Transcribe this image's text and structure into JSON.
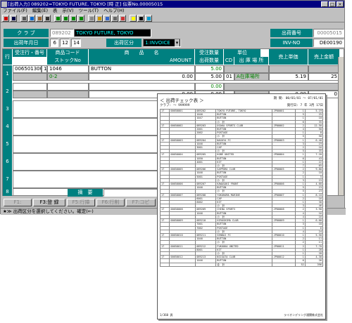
{
  "window": {
    "title": "[出荷入力] 089202=TOKYO FUTURE, TOKYO [時   正] 伝票No.00005015",
    "controls": [
      "_",
      "□",
      "×"
    ]
  },
  "menu": [
    "ファイル(F)",
    "編集(E)",
    "表",
    "示(V)",
    "ツール(T)",
    "ヘルプ(H)"
  ],
  "header": {
    "club_label": "ク ラ ブ",
    "club_code": "089202",
    "club_name": "TOKYO FUTURE, TOKYO",
    "shipment_no_label": "出荷番号",
    "shipment_no": "00005015",
    "ship_date_label": "出荷年月日",
    "ship_date_parts": [
      "6",
      "12",
      "14"
    ],
    "ship_div_label": "出荷区分",
    "ship_div_value": "1:INVOICE",
    "inv_no_label": "INV-NO",
    "inv_no": "DE00190"
  },
  "grid": {
    "columns": {
      "row": "行",
      "order_no": "受注行・番号",
      "product_code": "商品コード",
      "stock_no": "ストックNo",
      "product_name": "商　　品　　名",
      "amount": "AMOUNT",
      "order_qty": "受注数量",
      "ship_qty": "出荷数量",
      "cd": "CD",
      "unit": "単位",
      "location": "出 庫 場 所",
      "price": "売上単価",
      "sales_amount": "売上金額"
    },
    "rows": [
      {
        "num": "1",
        "order_no": "006501300",
        "order_line": "1",
        "product_code": "1046",
        "product_name": "BUTTON",
        "order_qty": "5.00",
        "ship_qty": "5.00",
        "unit": "01",
        "price": "5.19",
        "sales_amount": "25",
        "stock_no": "0-2",
        "amount": "0.00",
        "qty2": "0.00",
        "cd2": "01",
        "location": "A在庫場所"
      },
      {
        "num": "2",
        "amount": "0.00",
        "ship_qty": "0.00",
        "cd2": "",
        "price": "0.00",
        "sales_amount": "0",
        "order_qty": "0.00"
      },
      {
        "num": "3"
      },
      {
        "num": "4"
      },
      {
        "num": "5"
      },
      {
        "num": "6"
      },
      {
        "num": "7"
      },
      {
        "num": "8"
      }
    ],
    "summary_label": "摘　要"
  },
  "buttons": {
    "f1": "F1:",
    "f3": "F3:登 録",
    "f5": "F5:行挿",
    "f6": "F6:行削",
    "f7": "F7:コピ"
  },
  "status_message": "★≫ 出荷区分を選択してください。確定(←)",
  "report": {
    "title": "＜ 出荷チェック表 ＞",
    "club_label": "クラブ:",
    "club_range": "～ 999999",
    "period_label": "期 間: 00/01/01 ～ 07/01/01",
    "print_date": "発行日: 7 年 3月 17日",
    "page_label": "1",
    "rows": [
      [
        "17",
        "00650001",
        "089202",
        "TOKYO FUTURE, TOKYO",
        "JP00001",
        "1",
        "5.19"
      ],
      [
        "",
        "",
        "1046",
        "BUTTON",
        "",
        "5",
        "25"
      ],
      [
        "",
        "",
        "1047",
        "BUTTON",
        "",
        "1",
        "10"
      ],
      [
        "",
        "",
        "",
        "小　計",
        "",
        "6",
        "35"
      ],
      [
        "17",
        "00650002",
        "089203",
        "OSAKA SPORTS CLUB",
        "JP00002",
        "2",
        "12.50"
      ],
      [
        "",
        "",
        "2001",
        "BUTTON",
        "",
        "4",
        "50"
      ],
      [
        "",
        "",
        "2002",
        "POSTAGE",
        "",
        "1",
        "8"
      ],
      [
        "",
        "",
        "",
        "小　計",
        "",
        "5",
        "58"
      ],
      [
        "17",
        "00650003",
        "089204",
        "NAGOYA FC",
        "JP00003",
        "1",
        "6.40"
      ],
      [
        "",
        "",
        "1046",
        "BUTTON",
        "",
        "3",
        "19"
      ],
      [
        "",
        "",
        "3001",
        "CAP",
        "",
        "2",
        "16"
      ],
      [
        "",
        "",
        "",
        "小　計",
        "",
        "5",
        "35"
      ],
      [
        "17",
        "00650004",
        "089205",
        "KOBE UNITED",
        "JP00004",
        "1",
        "7.20"
      ],
      [
        "",
        "",
        "1050",
        "BUTTON",
        "",
        "6",
        "43"
      ],
      [
        "",
        "",
        "4001",
        "KIT",
        "",
        "1",
        "22"
      ],
      [
        "",
        "",
        "",
        "小　計",
        "",
        "7",
        "65"
      ],
      [
        "17",
        "00650005",
        "089206",
        "SAPPORO CLUB",
        "JP00005",
        "2",
        "9.80"
      ],
      [
        "",
        "",
        "1046",
        "BUTTON",
        "",
        "2",
        "10"
      ],
      [
        "",
        "",
        "5001",
        "POSTAGE",
        "",
        "1",
        "5"
      ],
      [
        "",
        "",
        "",
        "小　計",
        "",
        "3",
        "15"
      ],
      [
        "17",
        "00650006",
        "089207",
        "KAWASAKI FRONT",
        "JP00006",
        "1",
        "4.60"
      ],
      [
        "",
        "",
        "1046",
        "BUTTON",
        "",
        "5",
        "23"
      ],
      [
        "",
        "",
        "",
        "小　計",
        "",
        "5",
        "23"
      ],
      [
        "17",
        "00650007",
        "089208",
        "YOKOHAMA MARINE",
        "JP00007",
        "1",
        "8.10"
      ],
      [
        "",
        "",
        "6001",
        "CAP",
        "",
        "2",
        "16"
      ],
      [
        "",
        "",
        "6002",
        "KIT",
        "",
        "1",
        "30"
      ],
      [
        "",
        "",
        "",
        "小　計",
        "",
        "3",
        "46"
      ],
      [
        "17",
        "00650008",
        "089209",
        "CHIBA SPORTS",
        "JP00008",
        "2",
        "3.90"
      ],
      [
        "",
        "",
        "1046",
        "BUTTON",
        "",
        "4",
        "16"
      ],
      [
        "",
        "",
        "",
        "小　計",
        "",
        "4",
        "16"
      ],
      [
        "17",
        "00650009",
        "089210",
        "HIROSHIMA CLUB",
        "JP00009",
        "1",
        "6.00"
      ],
      [
        "",
        "",
        "7001",
        "BUTTON",
        "",
        "3",
        "18"
      ],
      [
        "",
        "",
        "7002",
        "POSTAGE",
        "",
        "1",
        "6"
      ],
      [
        "",
        "",
        "",
        "小　計",
        "",
        "4",
        "24"
      ],
      [
        "17",
        "00650010",
        "089211",
        "SENDAI FC",
        "JP00010",
        "1",
        "5.50"
      ],
      [
        "",
        "",
        "1046",
        "BUTTON",
        "",
        "2",
        "11"
      ],
      [
        "",
        "",
        "",
        "小　計",
        "",
        "2",
        "11"
      ],
      [
        "17",
        "00650011",
        "089212",
        "FUKUOKA UNITED",
        "JP00011",
        "2",
        "7.70"
      ],
      [
        "",
        "",
        "8001",
        "KIT",
        "",
        "1",
        "28"
      ],
      [
        "",
        "",
        "",
        "小　計",
        "",
        "1",
        "28"
      ],
      [
        "17",
        "00650012",
        "089213",
        "NIIGATA CLUB",
        "JP00012",
        "1",
        "4.30"
      ],
      [
        "",
        "",
        "1046",
        "BUTTON",
        "",
        "6",
        "26"
      ],
      [
        "",
        "",
        "",
        "合　計",
        "",
        "52",
        "396"
      ]
    ],
    "footer_page": "1/360 頁",
    "footer_company": "ライオンデリング通関株式会社"
  }
}
